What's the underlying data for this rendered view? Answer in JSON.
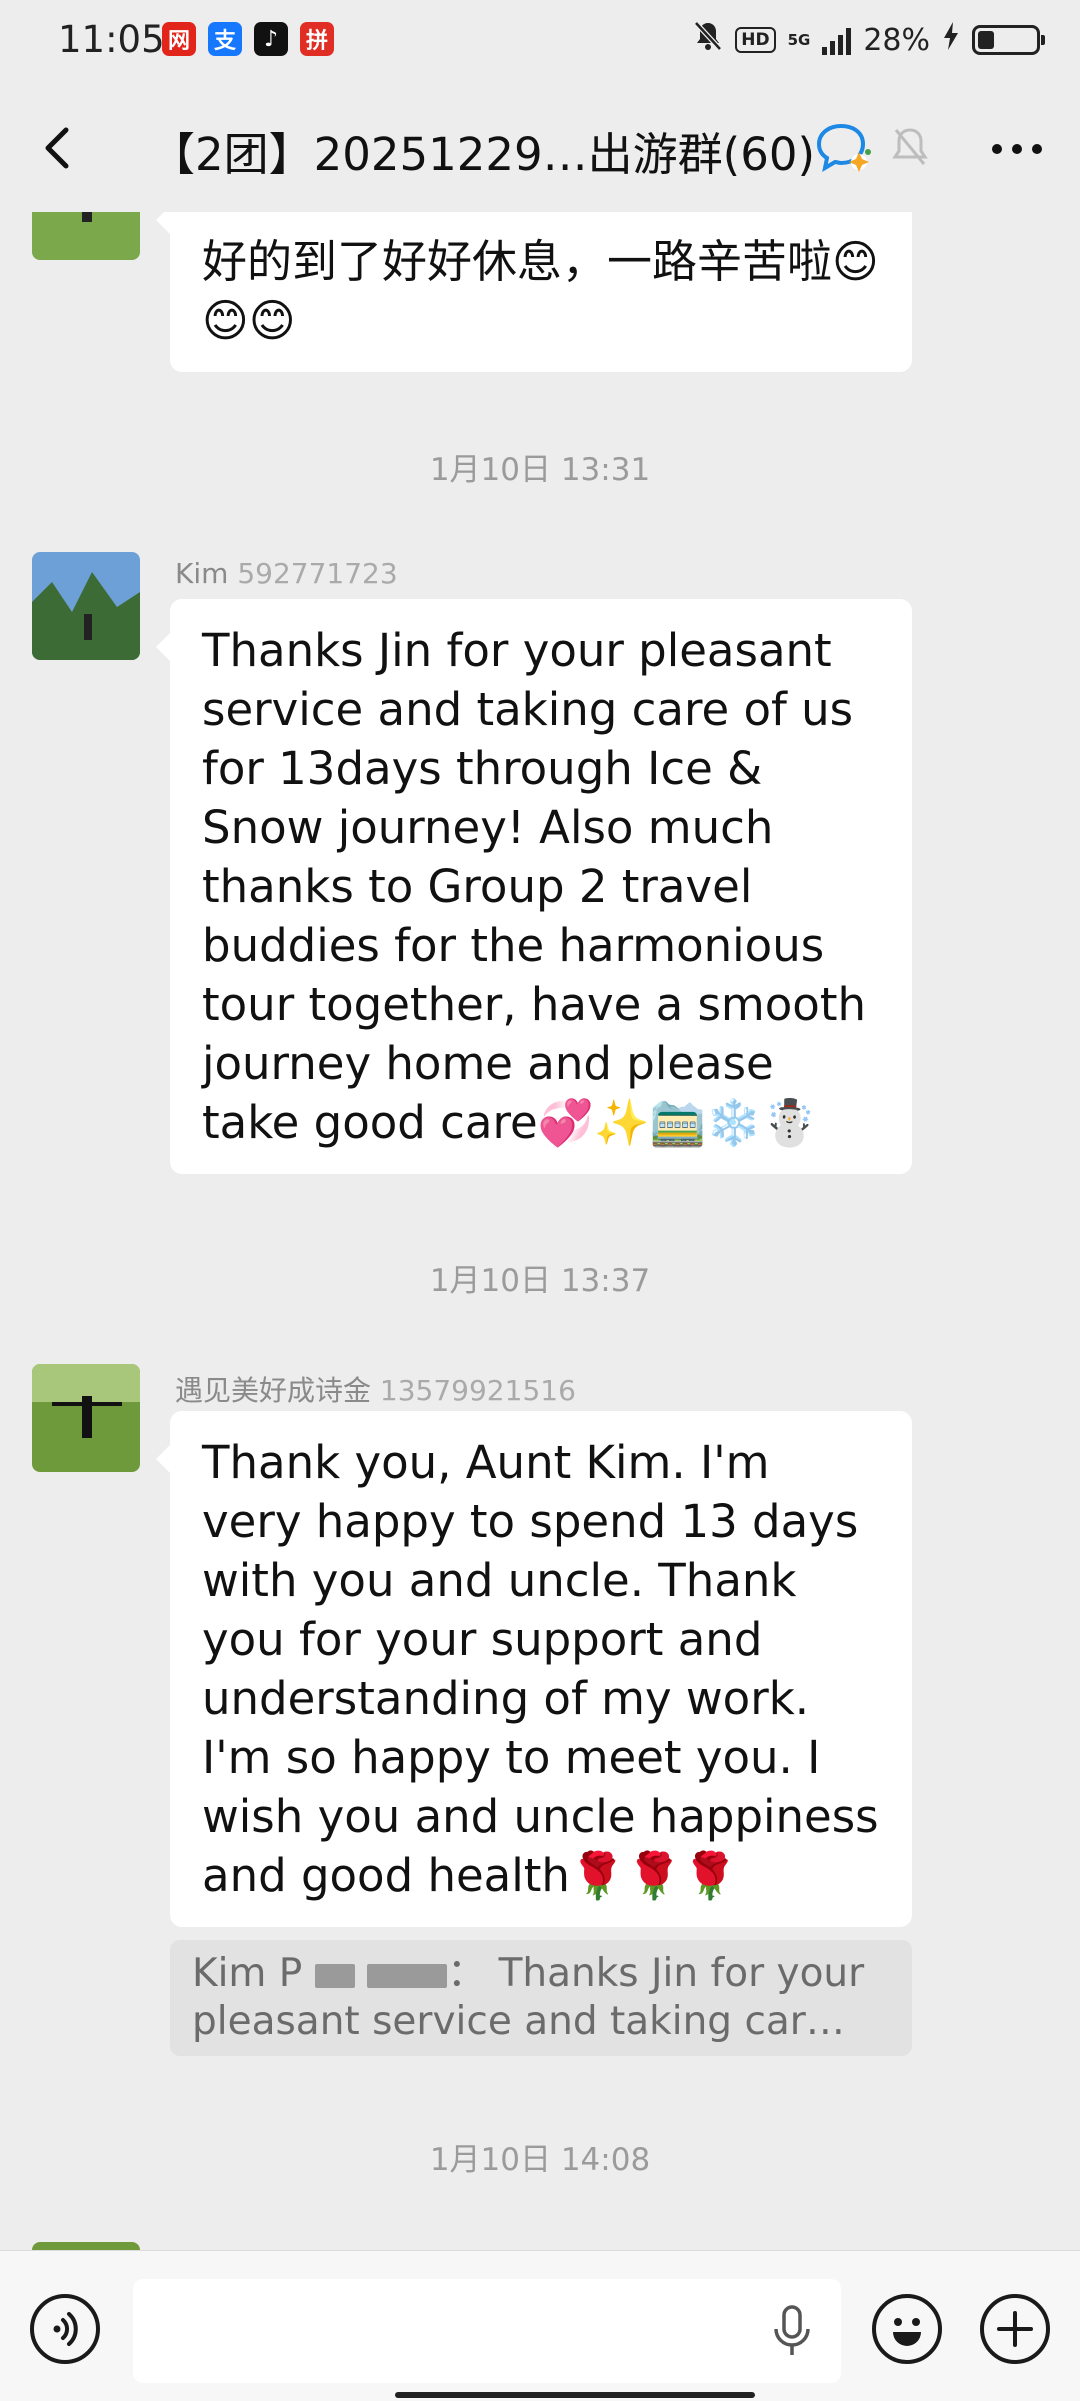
{
  "status_bar": {
    "time": "11:05",
    "apps": [
      "网",
      "支",
      "♪",
      "拼"
    ],
    "network": "5G",
    "hd": "HD",
    "battery_pct": "28%",
    "battery_level": 0.28
  },
  "header": {
    "title": "【2团】20251229…出游群(60)"
  },
  "messages": [
    {
      "text": "好的到了好好休息，一路辛苦啦😊😊😊"
    },
    {
      "timestamp": "1月10日 13:31",
      "sender": "Kim",
      "sender_suffix": "592771723",
      "text": "Thanks Jin for your pleasant service and taking care of us for 13days through Ice & Snow journey! Also much thanks to Group 2 travel buddies for the harmonious tour together, have a smooth journey home and please take good care💞✨🚞❄️☃️"
    },
    {
      "timestamp": "1月10日 13:37",
      "sender": "遇见美好成诗金",
      "sender_suffix": "13579921516",
      "text": "Thank you, Aunt Kim. I'm very happy to spend 13 days with you and uncle. Thank you for your support and understanding of my work. I'm so happy to meet you. I wish you and uncle happiness and good health🌹🌹🌹",
      "quote": {
        "sender": "Kim P",
        "separator": "：",
        "text": "Thanks Jin for your pleasant  service and taking car…"
      }
    },
    {
      "timestamp": "1月10日 14:08"
    }
  ],
  "colors": {
    "background": "#ededed",
    "bubble": "#ffffff",
    "timestamp": "#9b9b9b",
    "accent": "#1aad19"
  }
}
